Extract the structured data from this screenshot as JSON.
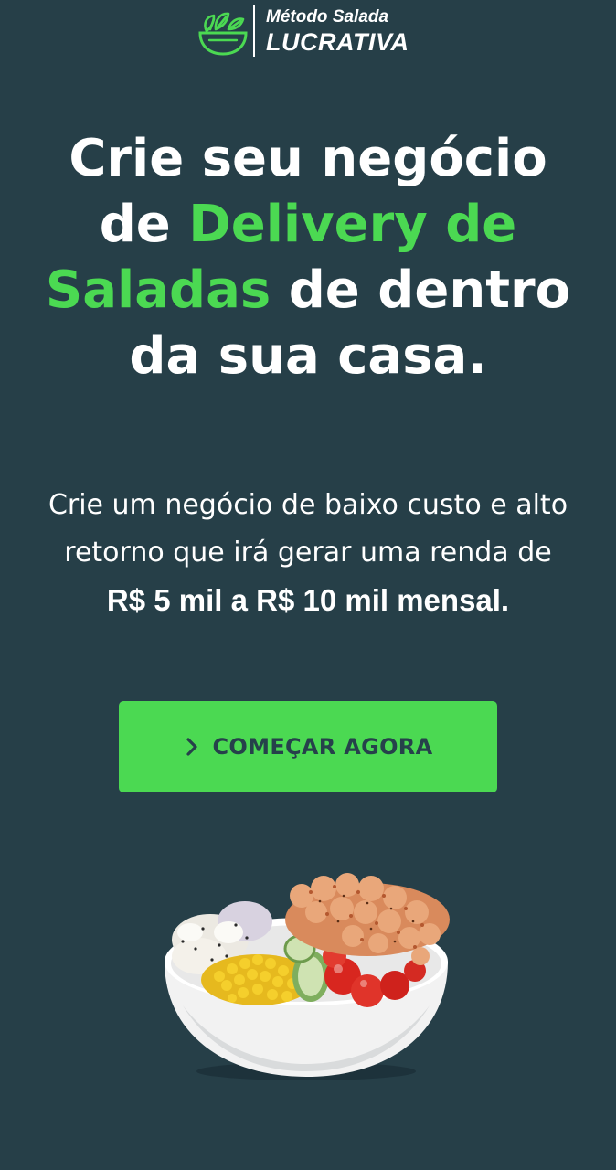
{
  "colors": {
    "background": "#263f48",
    "accent": "#4bd952",
    "text": "#ffffff",
    "button_text": "#26414b"
  },
  "header": {
    "logo": {
      "icon": "salad-bowl-icon",
      "line1": "Método Salada",
      "line2": "LUCRATIVA"
    }
  },
  "hero": {
    "title_part1": "Crie seu negócio de ",
    "title_highlight": "Delivery de Saladas",
    "title_part2": " de dentro da sua casa.",
    "subtitle_text": "Crie um negócio de baixo custo e alto retorno que irá gerar uma renda de",
    "subtitle_bold": "R$ 5 mil a R$ 10 mil mensal."
  },
  "cta": {
    "icon": "chevron-right-icon",
    "label": "COMEÇAR AGORA"
  },
  "image": {
    "subject": "salad-bowl-with-shrimp-corn-tomatoes-photo"
  }
}
